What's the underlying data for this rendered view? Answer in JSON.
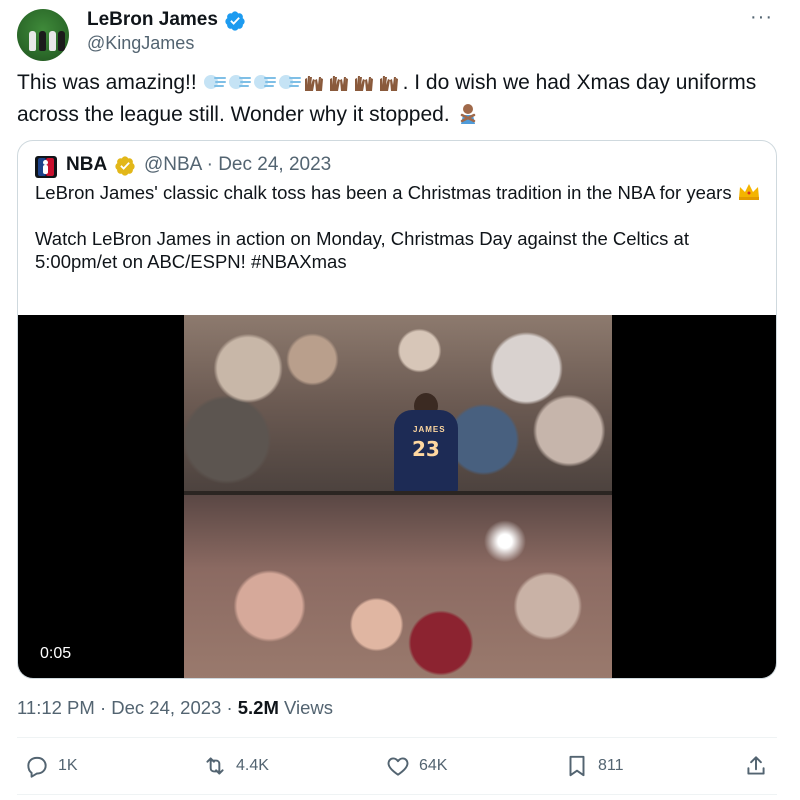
{
  "author": {
    "name": "LeBron James",
    "handle": "@KingJames"
  },
  "tweet": {
    "text_before_emoji": "This was amazing!! ",
    "emojis": [
      "wind-face-emoji",
      "wind-face-emoji",
      "wind-face-emoji",
      "wind-face-emoji",
      "raised-hands-emoji",
      "raised-hands-emoji",
      "raised-hands-emoji",
      "raised-hands-emoji"
    ],
    "text_after_emoji": ". I do wish we had Xmas day uniforms across the league still. Wonder why it stopped. ",
    "trailing_emoji": "man-gesturing-no-emoji"
  },
  "quote": {
    "name": "NBA",
    "handle_date": "@NBA · Dec 24, 2023",
    "para1": "LeBron James' classic chalk toss has been a Christmas tradition in the NBA for years ",
    "para1_emoji": "crown-emoji",
    "para2": "Watch LeBron James in action on Monday, Christmas Day against the Celtics at 5:00pm/et on ABC/ESPN! #NBAXmas",
    "video": {
      "timestamp": "0:05",
      "jersey_number": "23",
      "jersey_text": "JAMES"
    }
  },
  "meta": {
    "time_date": "11:12 PM · Dec 24, 2023 · ",
    "views_count": "5.2M",
    "views_label": " Views"
  },
  "actions": {
    "reply_count": "1K",
    "retweet_count": "4.4K",
    "like_count": "64K",
    "bookmark_count": "811"
  },
  "colors": {
    "text": "#0f1419",
    "secondary": "#536471",
    "verified_blue": "#1d9bf0",
    "verified_gold": "#e2b719",
    "border": "#cfd9de"
  }
}
